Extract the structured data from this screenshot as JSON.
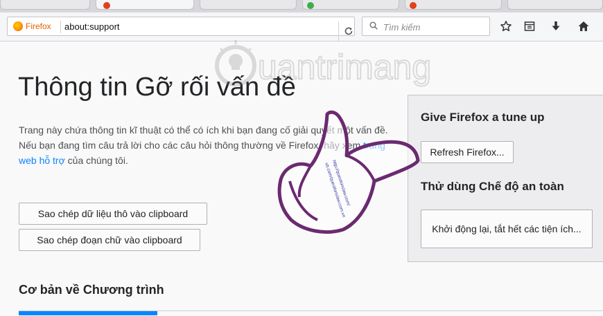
{
  "browser": {
    "identity_label": "Firefox",
    "url": "about:support",
    "search_placeholder": "Tìm kiếm",
    "icons": [
      "reload-icon",
      "search-icon",
      "bookmark-star-icon",
      "library-icon",
      "download-arrow-icon",
      "home-icon"
    ]
  },
  "page": {
    "title": "Thông tin Gỡ rối vấn đề",
    "intro_before_link": "Trang này chứa thông tin kĩ thuật có thể có ích khi bạn đang cố giải quyết một vấn đề. Nếu bạn đang tìm câu trả lời cho các câu hỏi thông thường về Firefox, hãy xem ",
    "intro_link": "trang web hỗ trợ",
    "intro_after_link": " của chúng tôi.",
    "copy_raw_button": "Sao chép dữ liệu thô vào clipboard",
    "copy_text_button": "Sao chép đoạn chữ vào clipboard",
    "section_heading": "Cơ bản về Chương trình"
  },
  "sidebox": {
    "tuneup_heading": "Give Firefox a tune up",
    "refresh_button": "Refresh Firefox...",
    "safemode_heading": "Thử dùng Chế độ an toàn",
    "restart_button": "Khởi động lại, tắt hết các tiện ích..."
  },
  "watermark": {
    "text": "uantrimang",
    "hand_text_line1": "http://questionslaw.com/",
    "hand_text_line2": "vb.com/questionslaw.com.vn"
  },
  "colors": {
    "link": "#0a84ff",
    "firefox_orange": "#e66000",
    "hand_outline": "#6b2a70"
  }
}
